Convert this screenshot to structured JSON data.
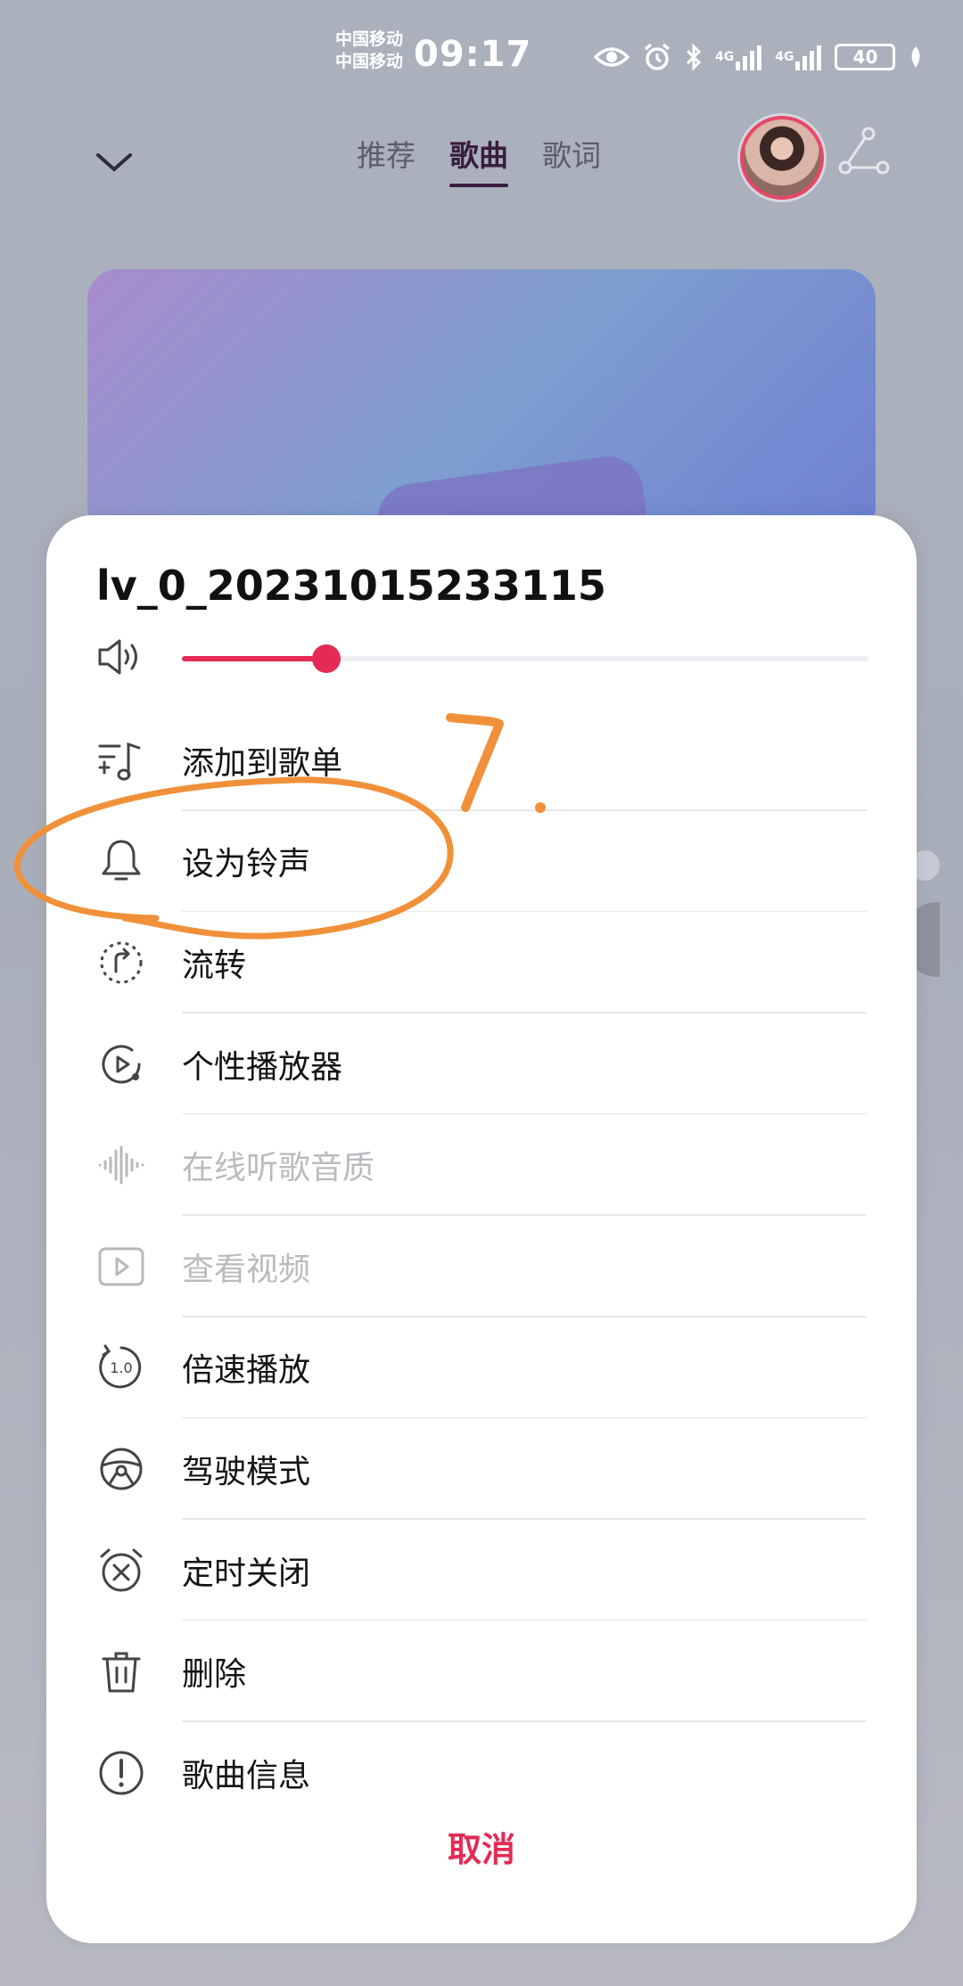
{
  "status_bar": {
    "carrier_1": "中国移动",
    "carrier_2": "中国移动",
    "time": "09:17",
    "network_1": "4G",
    "network_2": "4G",
    "battery": "40"
  },
  "nav": {
    "tabs": [
      {
        "label": "推荐",
        "active": false
      },
      {
        "label": "歌曲",
        "active": true
      },
      {
        "label": "歌词",
        "active": false
      }
    ]
  },
  "sheet": {
    "title": "lv_0_20231015233115",
    "volume_level": 0.21,
    "items": [
      {
        "label": "添加到歌单",
        "icon": "add-to-playlist-icon",
        "enabled": true
      },
      {
        "label": "设为铃声",
        "icon": "bell-icon",
        "enabled": true
      },
      {
        "label": "流转",
        "icon": "cast-transfer-icon",
        "enabled": true
      },
      {
        "label": "个性播放器",
        "icon": "custom-player-icon",
        "enabled": true
      },
      {
        "label": "在线听歌音质",
        "icon": "sound-wave-icon",
        "enabled": false
      },
      {
        "label": "查看视频",
        "icon": "video-icon",
        "enabled": false
      },
      {
        "label": "倍速播放",
        "icon": "playback-speed-icon",
        "enabled": true
      },
      {
        "label": "驾驶模式",
        "icon": "steering-wheel-icon",
        "enabled": true
      },
      {
        "label": "定时关闭",
        "icon": "sleep-timer-icon",
        "enabled": true
      },
      {
        "label": "删除",
        "icon": "trash-icon",
        "enabled": true
      },
      {
        "label": "歌曲信息",
        "icon": "info-icon",
        "enabled": true
      }
    ],
    "speed_badge": "1.0",
    "cancel_label": "取消"
  },
  "annotation": {
    "number": "7.",
    "color": "#f0913a"
  },
  "colors": {
    "accent": "#e42a55"
  }
}
